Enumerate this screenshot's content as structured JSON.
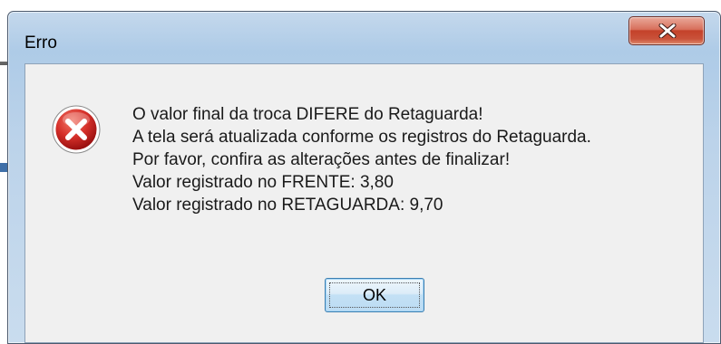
{
  "dialog": {
    "title": "Erro",
    "icon": "error-icon",
    "message_lines": [
      "O valor final da troca DIFERE do Retaguarda!",
      "A tela será atualizada conforme os registros do Retaguarda.",
      "Por favor, confira as alterações antes de finalizar!",
      "Valor registrado no FRENTE: 3,80",
      "Valor registrado no RETAGUARDA: 9,70"
    ],
    "ok_label": "OK",
    "close_icon": "close-icon"
  },
  "colors": {
    "close_button": "#c4412a",
    "error_icon": "#c42020",
    "content_bg": "#f0f0f0",
    "frame": "#b9d1ea"
  }
}
